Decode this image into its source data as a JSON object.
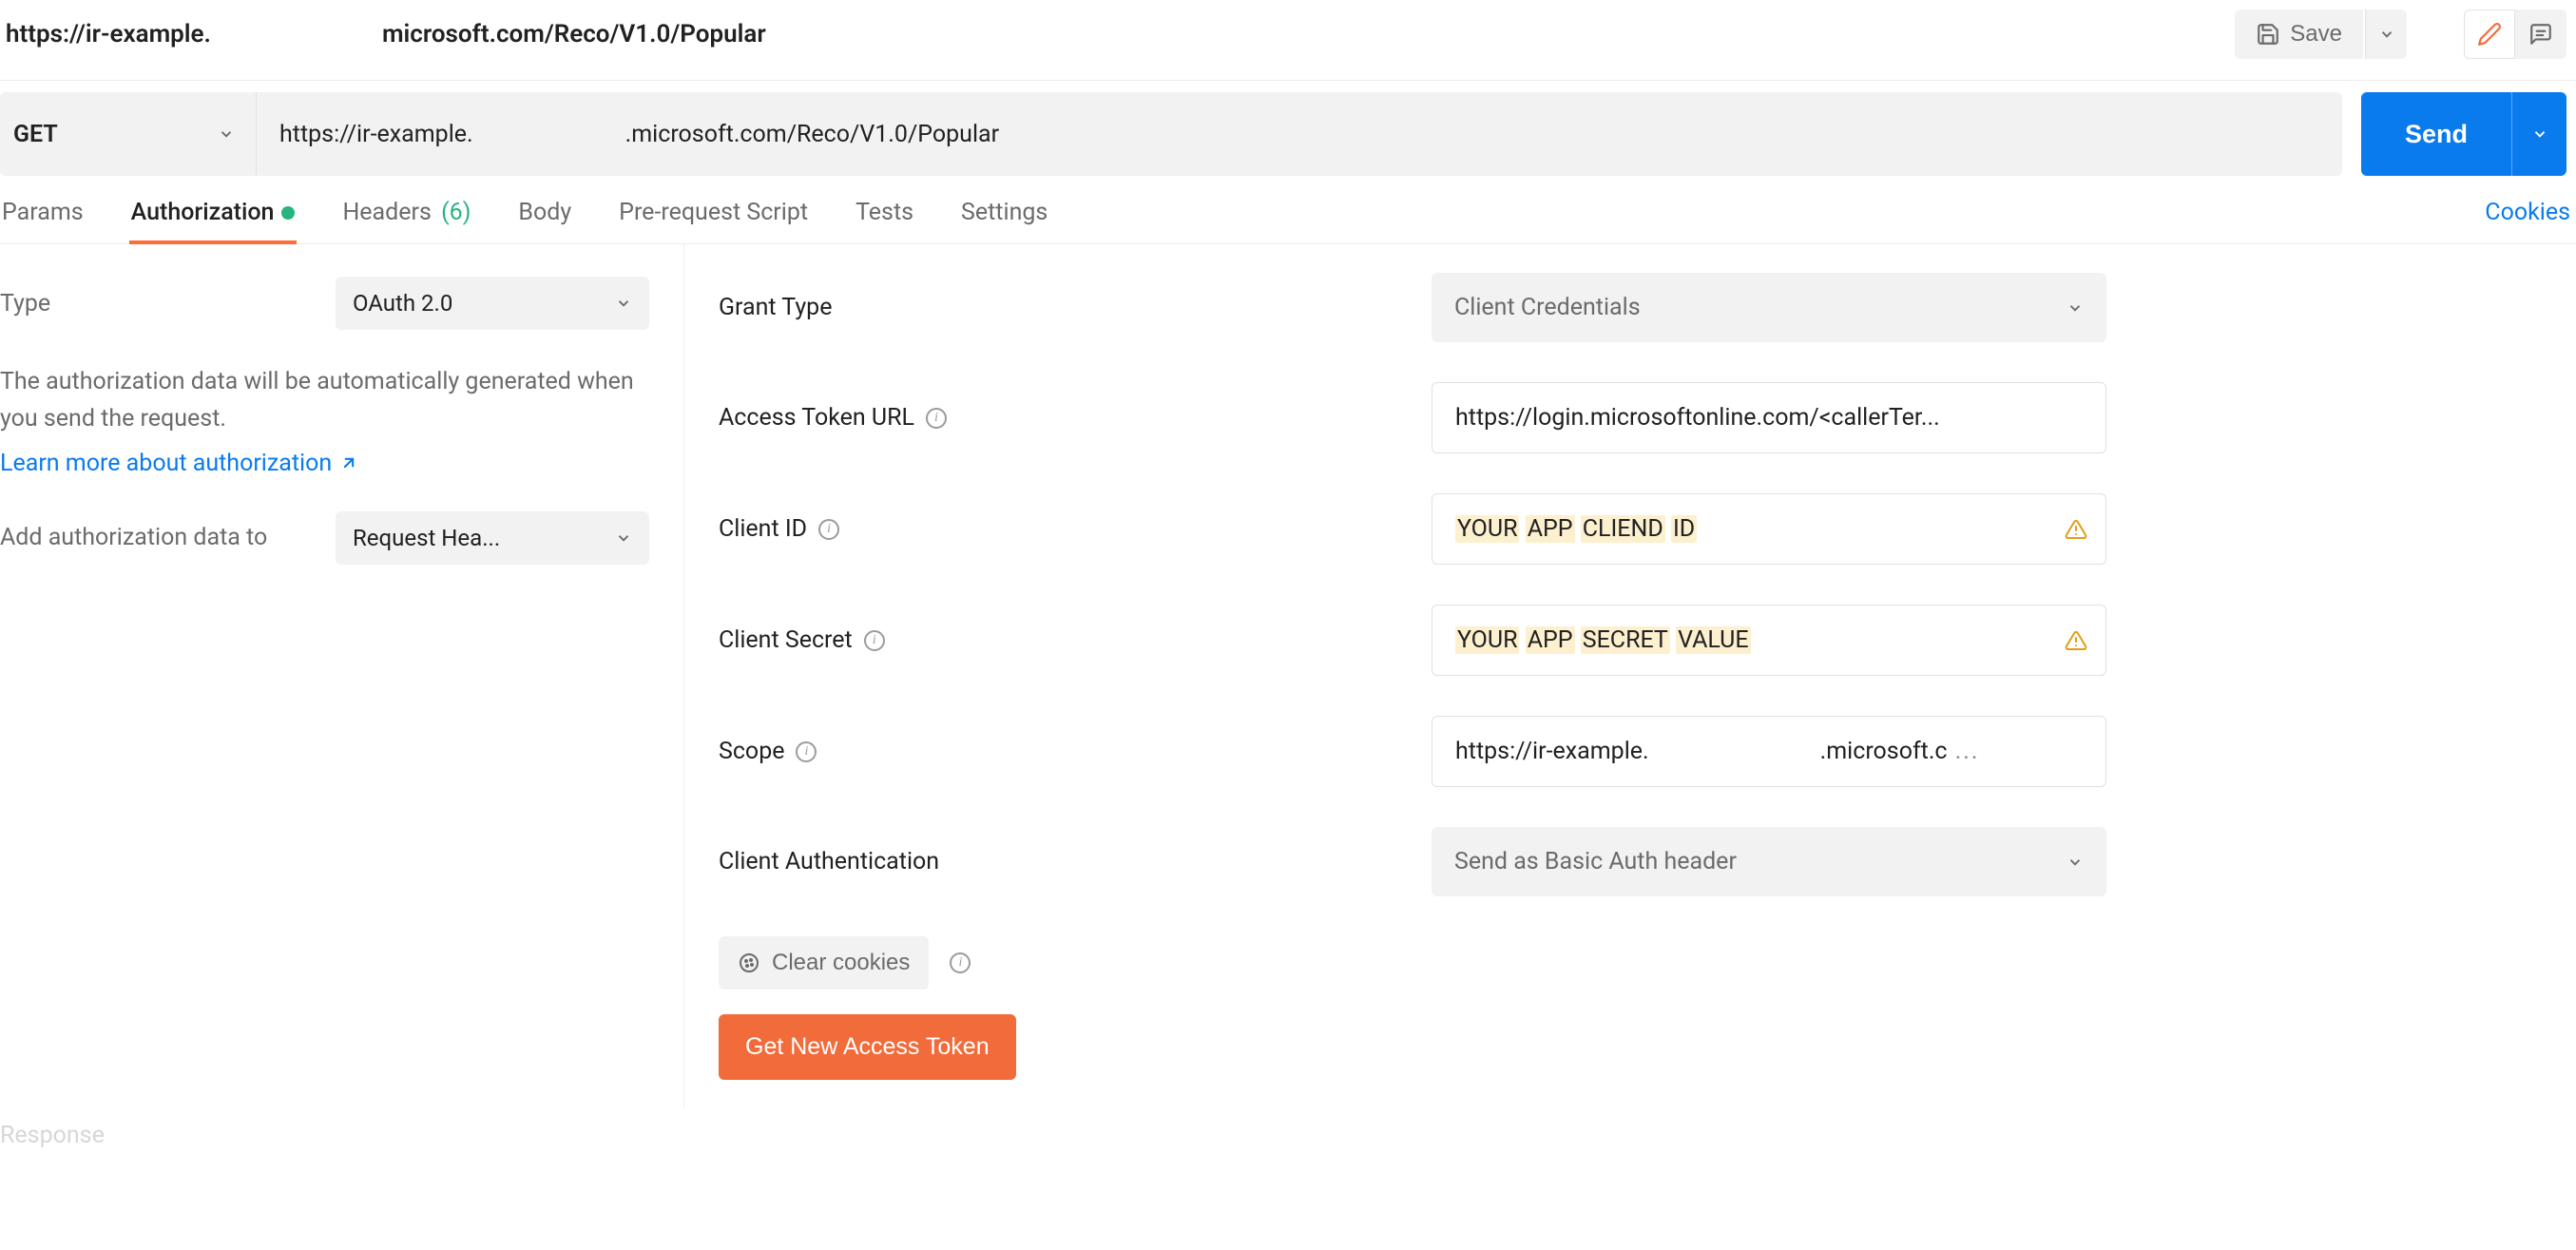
{
  "topbar": {
    "title_part1": "https://ir-example.",
    "title_part2": "microsoft.com/Reco/V1.0/Popular",
    "save_label": "Save"
  },
  "request": {
    "method": "GET",
    "url_part1": "https://ir-example.",
    "url_part2": ".microsoft.com/Reco/V1.0/Popular",
    "send_label": "Send"
  },
  "tabs": {
    "params": "Params",
    "authorization": "Authorization",
    "headers": "Headers",
    "headers_count": "(6)",
    "body": "Body",
    "prerequest": "Pre-request Script",
    "tests": "Tests",
    "settings": "Settings",
    "cookies": "Cookies"
  },
  "left": {
    "type_label": "Type",
    "type_value": "OAuth 2.0",
    "help_text": "The authorization data will be automatically generated when you send the request.",
    "learn_more": "Learn more about authorization",
    "add_to_label": "Add authorization data to",
    "add_to_value": "Request Hea..."
  },
  "form": {
    "grant_type_label": "Grant Type",
    "grant_type_value": "Client Credentials",
    "access_token_url_label": "Access Token URL",
    "access_token_url_value": "https://login.microsoftonline.com/<callerTer...",
    "client_id_label": "Client ID",
    "client_id_parts": [
      "YOUR",
      "APP",
      "CLIEND",
      "ID"
    ],
    "client_secret_label": "Client Secret",
    "client_secret_parts": [
      "YOUR",
      "APP",
      "SECRET",
      "VALUE"
    ],
    "scope_label": "Scope",
    "scope_part1": "https://ir-example.",
    "scope_part2": ".microsoft.c",
    "client_auth_label": "Client Authentication",
    "client_auth_value": "Send as Basic Auth header",
    "clear_cookies": "Clear cookies",
    "get_token": "Get New Access Token"
  },
  "footer": {
    "response": "Response"
  }
}
